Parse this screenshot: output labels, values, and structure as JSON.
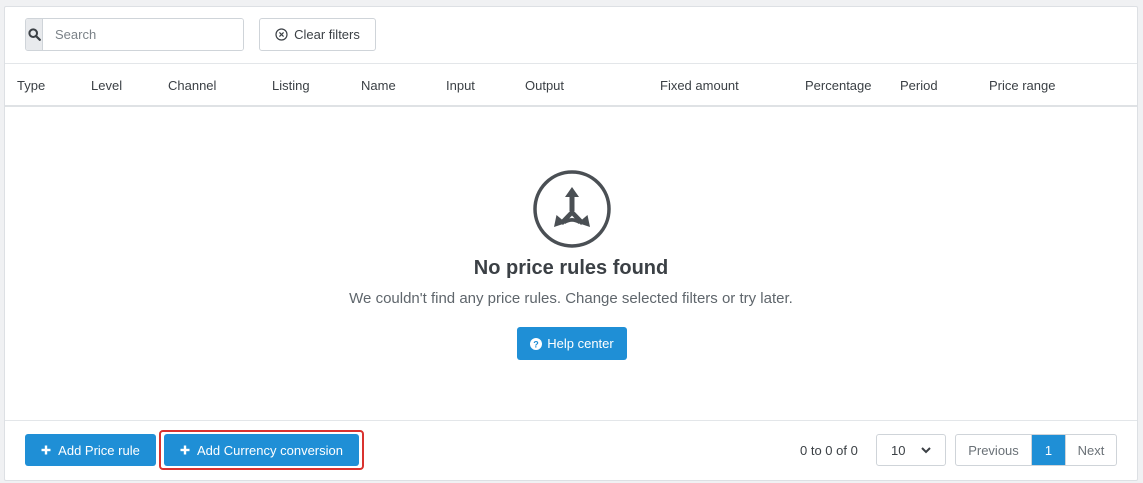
{
  "toolbar": {
    "search_placeholder": "Search",
    "clear_label": "Clear filters"
  },
  "table": {
    "columns": [
      "Type",
      "Level",
      "Channel",
      "Listing",
      "Name",
      "Input",
      "Output",
      "Fixed amount",
      "Percentage",
      "Period",
      "Price range"
    ]
  },
  "empty": {
    "title": "No price rules found",
    "message": "We couldn't find any price rules. Change selected filters or try later.",
    "help_label": "Help center"
  },
  "footer": {
    "add_price_rule": "Add Price rule",
    "add_currency_conversion": "Add Currency conversion",
    "range_info": "0 to 0 of 0",
    "page_size": "10",
    "previous": "Previous",
    "current_page": "1",
    "next": "Next"
  },
  "colors": {
    "accent": "#1f8fd6",
    "highlight": "#d9322f"
  },
  "icons": {
    "search": "search-icon",
    "clear": "circle-x-icon",
    "empty": "split-arrows-icon",
    "help": "question-circle-icon",
    "add": "plus-icon",
    "dropdown": "chevron-down-icon"
  }
}
